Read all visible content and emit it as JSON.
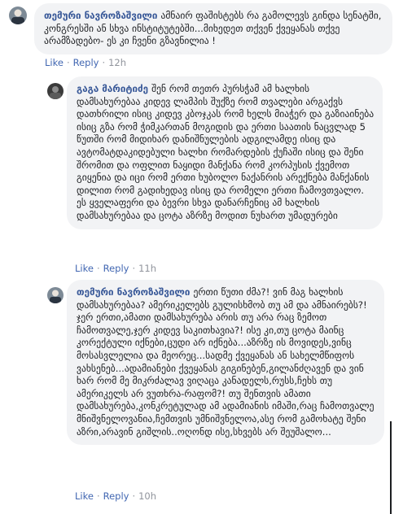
{
  "comments": [
    {
      "author": "თემური ნავროზაშვილი",
      "text": "ამნაირ ფაშისტებს რა გამოლევს გინდა სენატში, კონგრესში ან სხვა ინსტიტუტებში...მიხედეთ თქვენ ქვეყანას თქვე არამზადებო- ეს კი ჩვენი გზავნილია !",
      "like": "Like",
      "reply": "Reply",
      "time": "12h"
    },
    {
      "author": "გაგა მარიტიძე",
      "text": "შენ რომ თეთრ პურსჭამ ამ ხალხის დამსახურებაა კიდევ ლამპის შუქზე რომ თვალები არგაქვს დათხრილი ისიც კიდევ კბოჯკას რომ ხელს მიაჭერ და გაზიაინება ისიც გზა რომ ჭიმკართან მოგიდის და ერთი საათის ნაცვლად 5 წუთში რომ მიდიხარ დანიშნულების ადგილამდე ისიც და ავტომატდაკიდებული ხალხი რომარდების ქუჩაში ისიც და შენი შრომით და ოფლით ნაყიდი მანქანა რომ კორპუსის ქვემოთ გიყენია და იცი რომ ერთი ხუბოლო ნაქანრის არექნება მანქანის დილით რომ გადიხედავ ისიც და რომელი ერთი ჩამოვთვალო. ეს ყველაფერი და ბევრი სხვა დანარჩენიც ამ ხალხის დამსახურებაა და ცოტა აზრზე მოდით ნუხართ უმადურები",
      "like": "Like",
      "reply": "Reply",
      "time": "11h"
    },
    {
      "author": "თემური ნავროზაშვილი",
      "text": "ერთი წუთი ძმა?! ვინ მაგ ხალხის დამსახურებაა? ამერიკელებს გულისხმობ თუ ამ და ამნაირებს?! ჯერ ერთი,ამათი დამსახურება არის თუ არა რაც ზემოთ ჩამოთვალე,ჯერ კიდევ საკითხავია?! ისე კი,თუ ცოტა მაინც კორექტული იქნები,ცუდი არ იქნება...აზრზე ის მოვიდეს,ვინც მოსასვლელია და მეორეც...სადმე ქვეყანას ან სახელმწიფოს ვახსენებ...ადამიანები ქვეყანას გიგინებენ,გილანძღავენ და ვინ ხარ რომ მე მიკრძალავ ვიღაცა კანადელს,რუსს,ჩეხს თუ ამერიკელს არ ვუთხრა-რაფომ?! თუ შენთვის ამათი დამსახურება,კონკრეტულად ამ ადამიანის იმაში,რაც ჩამოთვალე მნიშვნელოვანია,ჩემთვის უმნიშვნელოა,ასე რომ გამოხატე შენი აზრი,არავინ გიშლის..ოღონდ ისე,სხვებს არ შეუშალო...",
      "like": "Like",
      "reply": "Reply",
      "time": "10h"
    }
  ]
}
